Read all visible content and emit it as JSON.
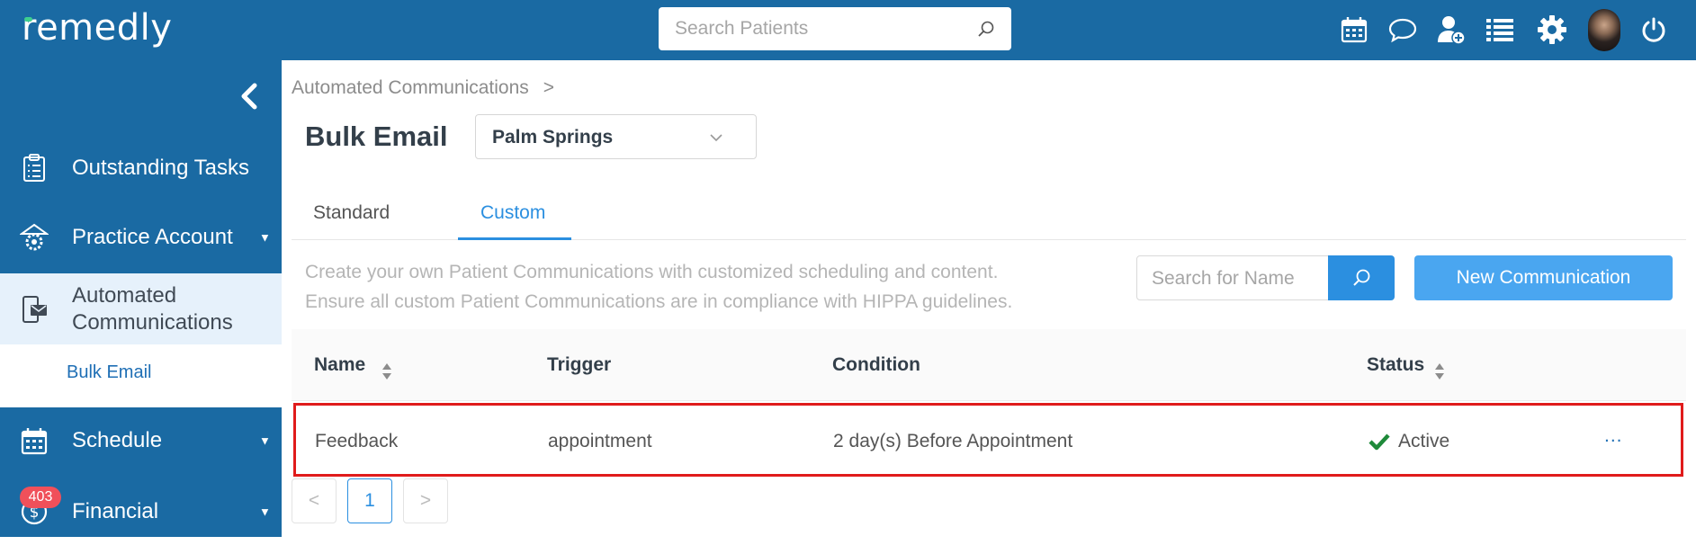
{
  "header": {
    "logo_text": "remedly",
    "search_placeholder": "Search Patients",
    "icons": [
      "calendar-icon",
      "chat-icon",
      "add-user-icon",
      "list-icon",
      "gear-icon",
      "avatar",
      "power-icon"
    ]
  },
  "sidebar": {
    "items": [
      {
        "label": "Outstanding Tasks",
        "icon": "clipboard-icon"
      },
      {
        "label": "Practice Account",
        "icon": "gear-building-icon"
      },
      {
        "label": "Automated Communications",
        "icon": "device-mail-icon"
      },
      {
        "label": "Schedule",
        "icon": "calendar-icon"
      },
      {
        "label": "Financial",
        "icon": "dollar-icon"
      }
    ],
    "sub_item": "Bulk Email",
    "financial_badge": "403"
  },
  "breadcrumb": {
    "root": "Automated Communications",
    "separator": ">"
  },
  "page": {
    "title": "Bulk Email",
    "location": "Palm Springs"
  },
  "tabs": [
    {
      "label": "Standard"
    },
    {
      "label": "Custom"
    }
  ],
  "active_tab": "Custom",
  "description": {
    "line1": "Create your own Patient Communications with customized scheduling and content.",
    "line2": "Ensure all custom Patient Communications are in compliance with HIPPA guidelines."
  },
  "name_search_placeholder": "Search for Name",
  "new_button_label": "New Communication",
  "table": {
    "columns": [
      "Name",
      "Trigger",
      "Condition",
      "Status"
    ],
    "rows": [
      {
        "name": "Feedback",
        "trigger": "appointment",
        "condition": "2 day(s) Before Appointment",
        "status": "Active",
        "more": "..."
      }
    ]
  },
  "pagination": {
    "prev": "<",
    "current": "1",
    "next": ">"
  },
  "colors": {
    "brand": "#1a6aa3",
    "accent": "#2b8fe0",
    "status_active": "#1e8a3a",
    "highlight": "#e01b1b"
  }
}
